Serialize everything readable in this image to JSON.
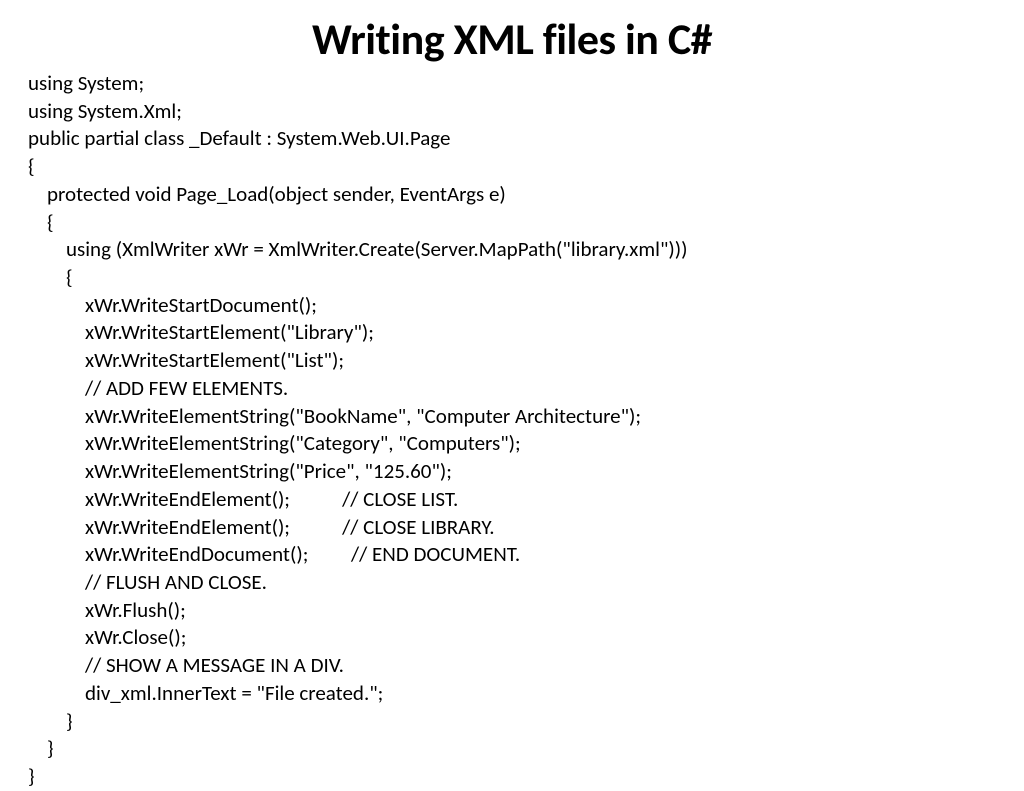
{
  "title": "Writing XML files in C#",
  "code": "using System;\nusing System.Xml;\npublic partial class _Default : System.Web.UI.Page\n{\n    protected void Page_Load(object sender, EventArgs e)\n    {\n        using (XmlWriter xWr = XmlWriter.Create(Server.MapPath(\"library.xml\")))\n        {\n            xWr.WriteStartDocument();\n            xWr.WriteStartElement(\"Library\");\n            xWr.WriteStartElement(\"List\");\n            // ADD FEW ELEMENTS.\n            xWr.WriteElementString(\"BookName\", \"Computer Architecture\");\n            xWr.WriteElementString(\"Category\", \"Computers\");\n            xWr.WriteElementString(\"Price\", \"125.60\");\n            xWr.WriteEndElement();           // CLOSE LIST.\n            xWr.WriteEndElement();           // CLOSE LIBRARY.\n            xWr.WriteEndDocument();         // END DOCUMENT.\n            // FLUSH AND CLOSE.\n            xWr.Flush();\n            xWr.Close();\n            // SHOW A MESSAGE IN A DIV.\n            div_xml.InnerText = \"File created.\";\n        }\n    }\n}"
}
